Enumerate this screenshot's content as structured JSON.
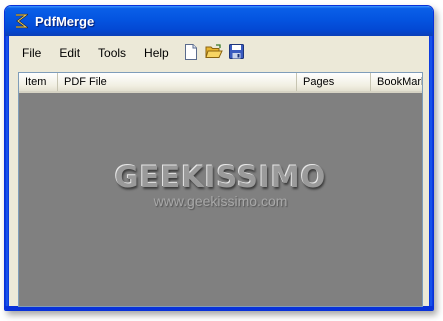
{
  "window": {
    "title": "PdfMerge"
  },
  "menu": {
    "items": [
      {
        "label": "File"
      },
      {
        "label": "Edit"
      },
      {
        "label": "Tools"
      },
      {
        "label": "Help"
      }
    ]
  },
  "toolbar": {
    "buttons": [
      {
        "icon": "new-document-icon"
      },
      {
        "icon": "open-folder-icon"
      },
      {
        "icon": "save-disk-icon"
      }
    ]
  },
  "list": {
    "columns": [
      "Item",
      "PDF File",
      "Pages",
      "BookMark"
    ]
  },
  "watermark": {
    "title": "GEEKISSIMO",
    "url": "www.geekissimo.com"
  }
}
